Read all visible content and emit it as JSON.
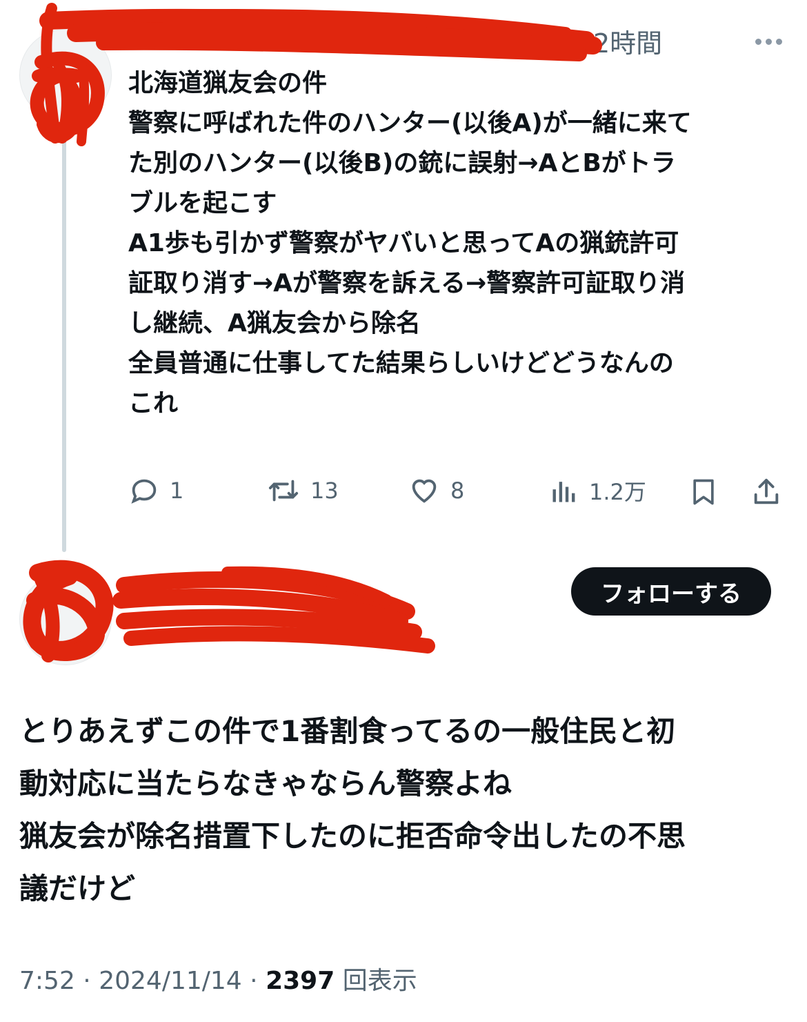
{
  "original_post": {
    "time": "2時間",
    "text": [
      "北海道猟友会の件",
      "警察に呼ばれた件のハンター(以後A)が一緒に来て",
      "た別のハンター(以後B)の銃に誤射→AとBがトラ",
      "ブルを起こす",
      "A1歩も引かず警察がヤバいと思ってAの猟銃許可",
      "証取り消す→Aが警察を訴える→警察許可証取り消",
      "し継続、A猟友会から除名",
      "",
      "全員普通に仕事してた結果らしいけどどうなんの",
      "これ"
    ],
    "actions": {
      "replies": "1",
      "reposts": "13",
      "likes": "8",
      "views": "1.2万"
    }
  },
  "reply": {
    "follow_label": "フォローする",
    "text": [
      "とりあえずこの件で1番割食ってるの一般住民と初",
      "動対応に当たらなきゃならん警察よね",
      "猟友会が除名措置下したのに拒否命令出したの不思",
      "議だけど"
    ],
    "meta": {
      "time": "7:52",
      "date": "2024/11/14",
      "views_count": "2397",
      "views_label": "回表示",
      "separator": "·"
    }
  },
  "colors": {
    "text": "#0f1419",
    "secondary": "#536471",
    "redaction": "#e0260e",
    "follow_bg": "#0f1419"
  }
}
